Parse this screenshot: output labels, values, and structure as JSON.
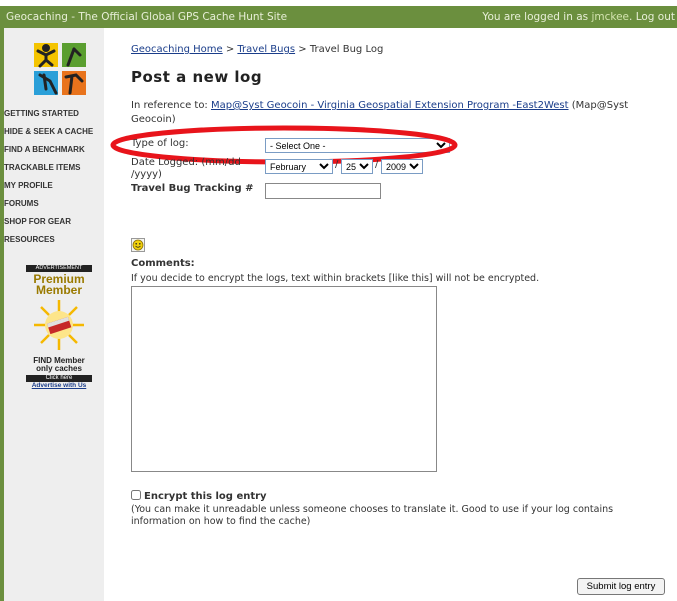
{
  "header": {
    "site_title": "Geocaching - The Official Global GPS Cache Hunt Site",
    "login_prefix": "You are logged in as ",
    "username": "jmckee",
    "logout": "Log out"
  },
  "sidebar": {
    "items": [
      {
        "label": "GETTING STARTED"
      },
      {
        "label": "HIDE & SEEK A CACHE"
      },
      {
        "label": "FIND A BENCHMARK"
      },
      {
        "label": "TRACKABLE ITEMS"
      },
      {
        "label": "MY PROFILE"
      },
      {
        "label": "FORUMS"
      },
      {
        "label": "SHOP FOR GEAR"
      },
      {
        "label": "RESOURCES"
      }
    ],
    "ad": {
      "label": "ADVERTISEMENT",
      "premium": "Premium Member",
      "find": "FIND Member only caches",
      "click_here": "Click here",
      "advertise": "Advertise with Us"
    }
  },
  "breadcrumb": {
    "home": "Geocaching Home",
    "sep1": " > ",
    "bugs": "Travel Bugs",
    "sep2": " > ",
    "current": "Travel Bug Log"
  },
  "page_title": "Post a new log",
  "reference": {
    "prefix": "In reference to: ",
    "link": "Map@Syst Geocoin - Virginia Geospatial Extension Program -East2West",
    "suffix": " (Map@Syst Geocoin)"
  },
  "form": {
    "type_label": "Type of log:",
    "type_selected": "- Select One -",
    "date_label": "Date Logged: (mm/dd /yyyy)",
    "month": "February",
    "day": "25",
    "year": "2009",
    "slash": "/",
    "tracking_label": "Travel Bug Tracking #",
    "tracking_value": ""
  },
  "comments": {
    "label": "Comments:",
    "hint": "If you decide to encrypt the logs, text within brackets [like this] will not be encrypted.",
    "value": ""
  },
  "encrypt": {
    "label": "Encrypt this log entry",
    "hint": "(You can make it unreadable unless someone chooses to translate it. Good to use if your log contains information on how to find the cache)",
    "checked": false
  },
  "submit_label": "Submit log entry",
  "colors": {
    "header_green": "#6b8f3e",
    "highlight_red": "#e8141b",
    "link_blue": "#1a3d8a"
  }
}
